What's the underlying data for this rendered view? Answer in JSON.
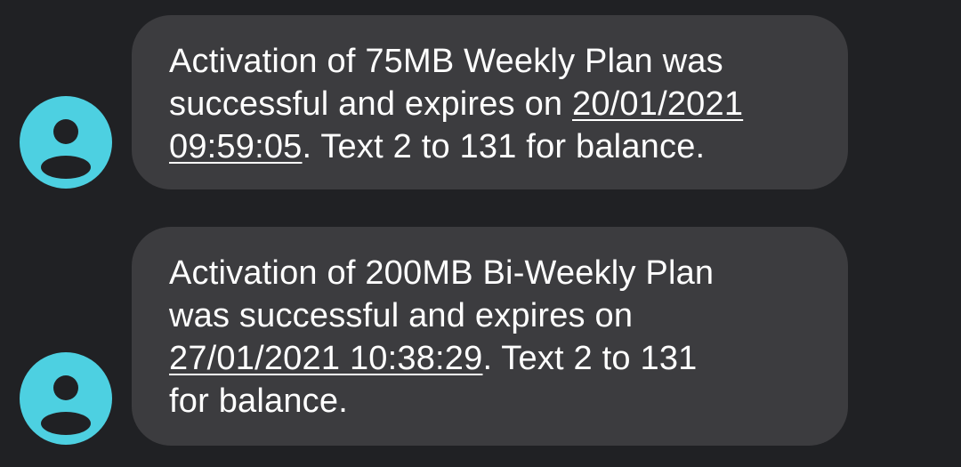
{
  "conversation": {
    "messages": [
      {
        "line1": "Activation of 75MB Weekly Plan was",
        "line2_text": "successful and expires on ",
        "date_part1": "20/01/2021",
        "date_part2": "09:59:05",
        "line3_tail": ". Text 2 to 131 for balance."
      },
      {
        "line1": "Activation of 200MB Bi-Weekly Plan",
        "line2": "was successful and expires on",
        "datetime": "27/01/2021 10:38:29",
        "line3_tail": ". Text 2 to 131",
        "line4": "for balance."
      }
    ]
  },
  "colors": {
    "background": "#202124",
    "bubble": "#3c3c3f",
    "avatar": "#4dd0e1",
    "avatar_glyph": "#202124",
    "text": "#ffffff"
  },
  "icons": {
    "avatar_icon": "person-icon"
  }
}
